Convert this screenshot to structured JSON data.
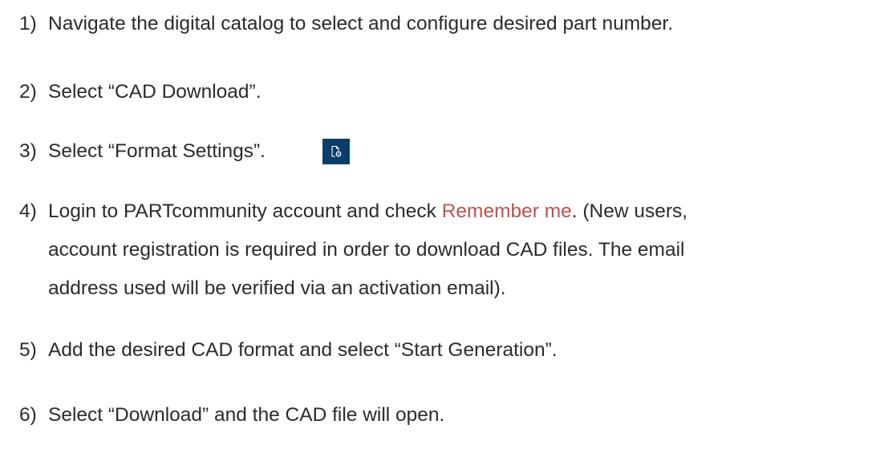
{
  "steps": [
    {
      "number": "1)",
      "lines": [
        "Navigate the digital catalog to select and configure desired part number."
      ]
    },
    {
      "number": "2)",
      "lines": [
        "Select “CAD Download”."
      ]
    },
    {
      "number": "3)",
      "lines": [
        "Select “Format Settings”."
      ],
      "icon": "file-settings-icon"
    },
    {
      "number": "4)",
      "line1_before": "Login to PARTcommunity account and check ",
      "line1_highlight": "Remember me",
      "line1_after": ". (New users,",
      "lines": [
        "account registration is required in order to download CAD files. The email",
        "address used will be verified via an activation email)."
      ]
    },
    {
      "number": "5)",
      "lines": [
        "Add the desired CAD format and select “Start Generation”."
      ]
    },
    {
      "number": "6)",
      "lines": [
        "Select “Download” and the CAD file will open."
      ]
    }
  ],
  "colors": {
    "text": "#2b2b2b",
    "highlight": "#c0504d",
    "icon_bg": "#0b3d6b"
  }
}
